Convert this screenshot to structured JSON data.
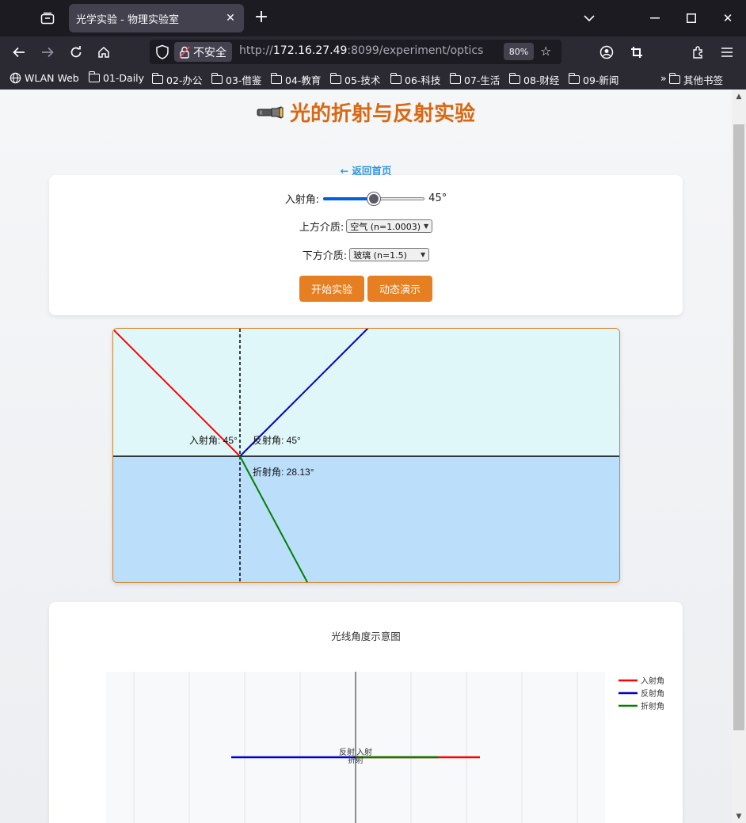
{
  "browser": {
    "tab_title": "光学实验 - 物理实验室",
    "insecure_label": "不安全",
    "url_prefix": "http://",
    "url_host": "172.16.27.49",
    "url_rest": ":8099/experiment/optics",
    "zoom": "80%",
    "bookmarks": [
      "WLAN Web",
      "01-Daily",
      "02-办公",
      "03-借鉴",
      "04-教育",
      "05-技术",
      "06-科技",
      "07-生活",
      "08-财经",
      "09-新闻"
    ],
    "other_bookmarks": "其他书签"
  },
  "page": {
    "title": "光的折射与反射实验",
    "back_link": "← 返回首页"
  },
  "controls": {
    "incident_label": "入射角:",
    "incident_value": "45°",
    "incident_fraction": 0.5,
    "upper_label": "上方介质:",
    "upper_value": "空气 (n=1.0003)",
    "lower_label": "下方介质:",
    "lower_value": "玻璃 (n=1.5)",
    "start_button": "开始实验",
    "animate_button": "动态演示"
  },
  "simulation": {
    "incident_angle_deg": 45,
    "refraction_angle_deg": 28.13,
    "incident_text": "入射角: 45°",
    "reflection_text": "反射角: 45°",
    "refraction_text": "折射角: 28.13°",
    "colors": {
      "upper": "#e0f7fa",
      "lower": "#bbdefb",
      "incident": "#ff0000",
      "reflected": "#0000cc",
      "refracted": "#008000"
    }
  },
  "chart_data": {
    "type": "line",
    "title": "光线角度示意图",
    "legend": "top-right",
    "grid": true,
    "series": [
      {
        "name": "入射角",
        "color": "#ff0000",
        "label": "入射",
        "angle": 45
      },
      {
        "name": "反射角",
        "color": "#0000cc",
        "label": "反射",
        "angle": 45
      },
      {
        "name": "折射角",
        "color": "#008000",
        "label": "折射",
        "angle": 28.13
      }
    ]
  }
}
